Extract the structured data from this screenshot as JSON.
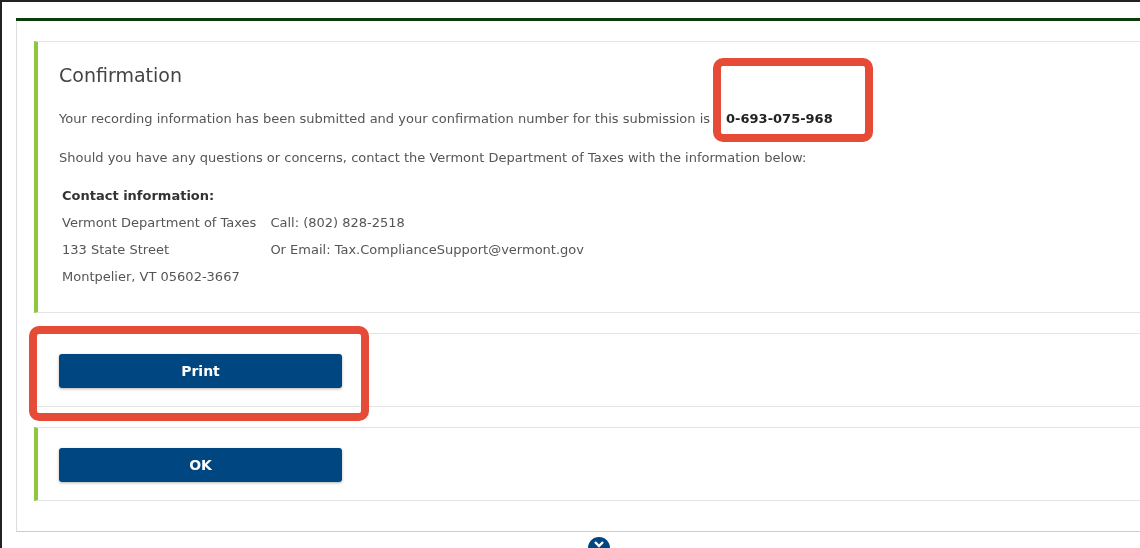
{
  "confirmation": {
    "title": "Confirmation",
    "message": "Your recording information has been submitted and your confirmation number for this submission is",
    "confirmation_number": {
      "text": "0-693-075-968",
      "annotated": true
    },
    "contact_prompt": "Should you have any questions or concerns, contact the Vermont Department of Taxes with the information below:",
    "contact_heading": "Contact information:",
    "address_lines": [
      "Vermont Department of Taxes",
      "133 State Street",
      "Montpelier, VT 05602-3667"
    ],
    "contact_lines": [
      "Call: (802) 828-2518",
      "Or Email: Tax.ComplianceSupport@vermont.gov"
    ]
  },
  "actions": [
    {
      "label": "Print",
      "annotated": true,
      "accent": false
    },
    {
      "label": "OK",
      "annotated": false,
      "accent": true
    }
  ]
}
